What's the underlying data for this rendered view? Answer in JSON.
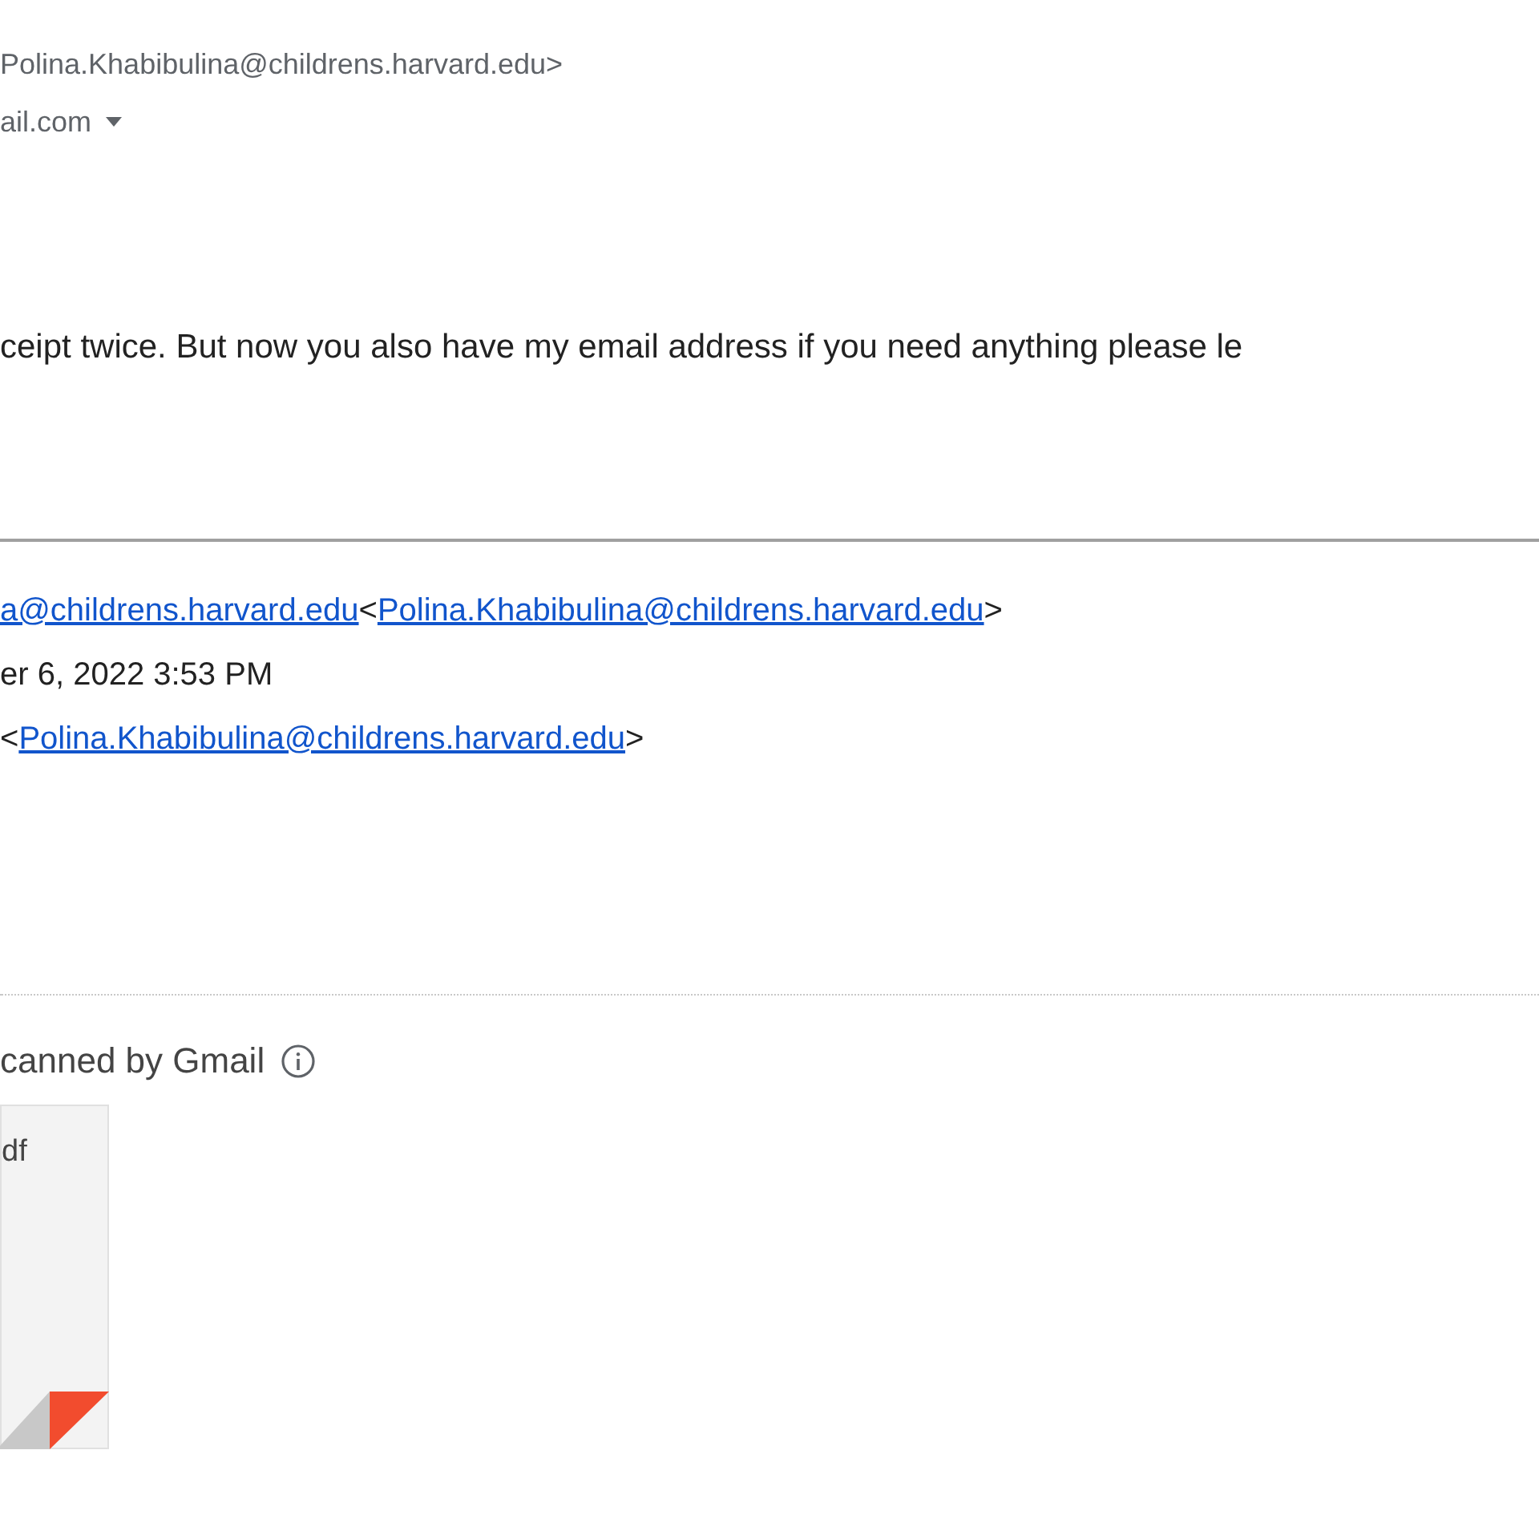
{
  "header": {
    "sender_address": "Polina.Khabibulina@childrens.harvard.edu>",
    "recipient": "ail.com"
  },
  "body": "ceipt twice. But now you also have my email address if you need anything please le",
  "quoted": {
    "from_name_link": "a@childrens.harvard.edu",
    "from_open": "<",
    "from_address_link": "Polina.Khabibulina@childrens.harvard.edu",
    "from_close": ">",
    "date": "er 6, 2022 3:53 PM",
    "to_open": "<",
    "to_address_link": "Polina.Khabibulina@childrens.harvard.edu",
    "to_close": ">"
  },
  "attachments": {
    "notice": "canned by Gmail",
    "files": [
      {
        "name": "df"
      }
    ]
  }
}
